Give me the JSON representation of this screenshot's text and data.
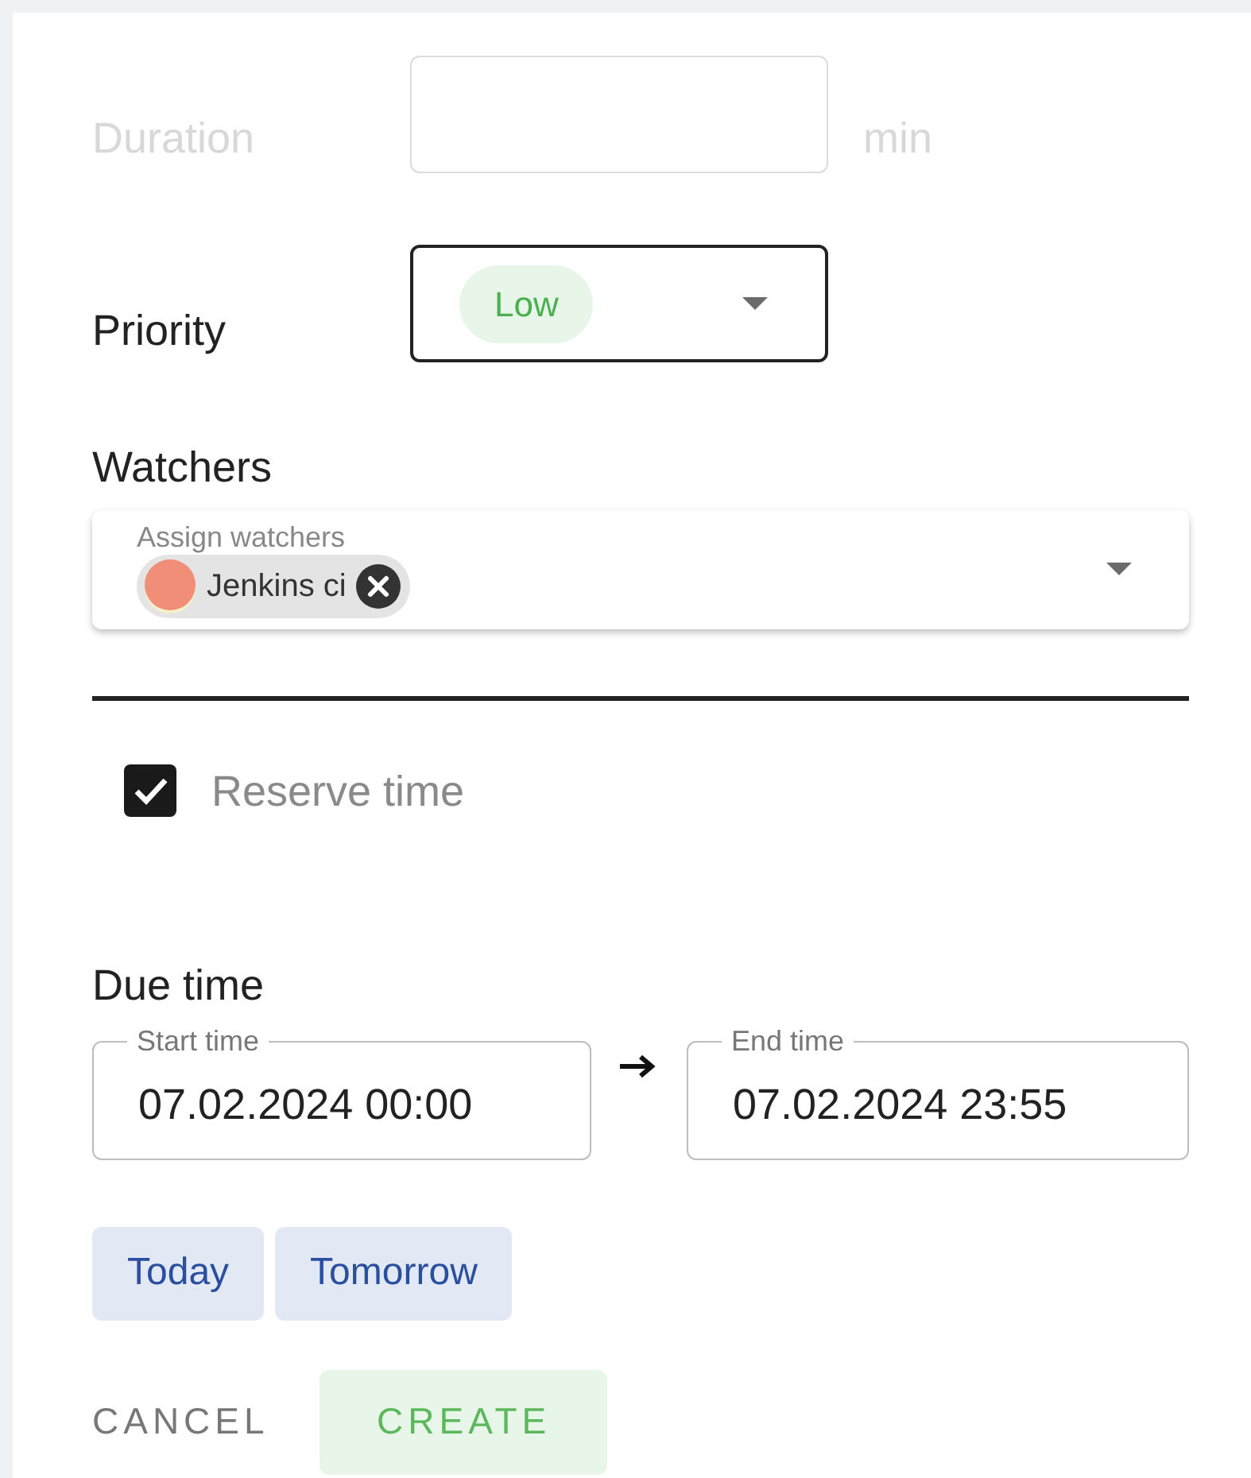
{
  "duration": {
    "label": "Duration",
    "unit": "min",
    "disabled": true
  },
  "priority": {
    "label": "Priority",
    "value": "Low"
  },
  "watchers": {
    "label": "Watchers",
    "field_label": "Assign watchers",
    "chips": [
      {
        "name": "Jenkins ci"
      }
    ]
  },
  "reserve_time": {
    "label": "Reserve time",
    "checked": true
  },
  "due_time": {
    "label": "Due time",
    "start": {
      "label": "Start time",
      "value": "07.02.2024 00:00"
    },
    "end": {
      "label": "End time",
      "value": "07.02.2024 23:55"
    }
  },
  "quick_buttons": [
    {
      "label": "Today"
    },
    {
      "label": "Tomorrow"
    }
  ],
  "actions": [
    {
      "label": "CANCEL",
      "kind": "text"
    },
    {
      "label": "CREATE",
      "kind": "primary"
    }
  ]
}
